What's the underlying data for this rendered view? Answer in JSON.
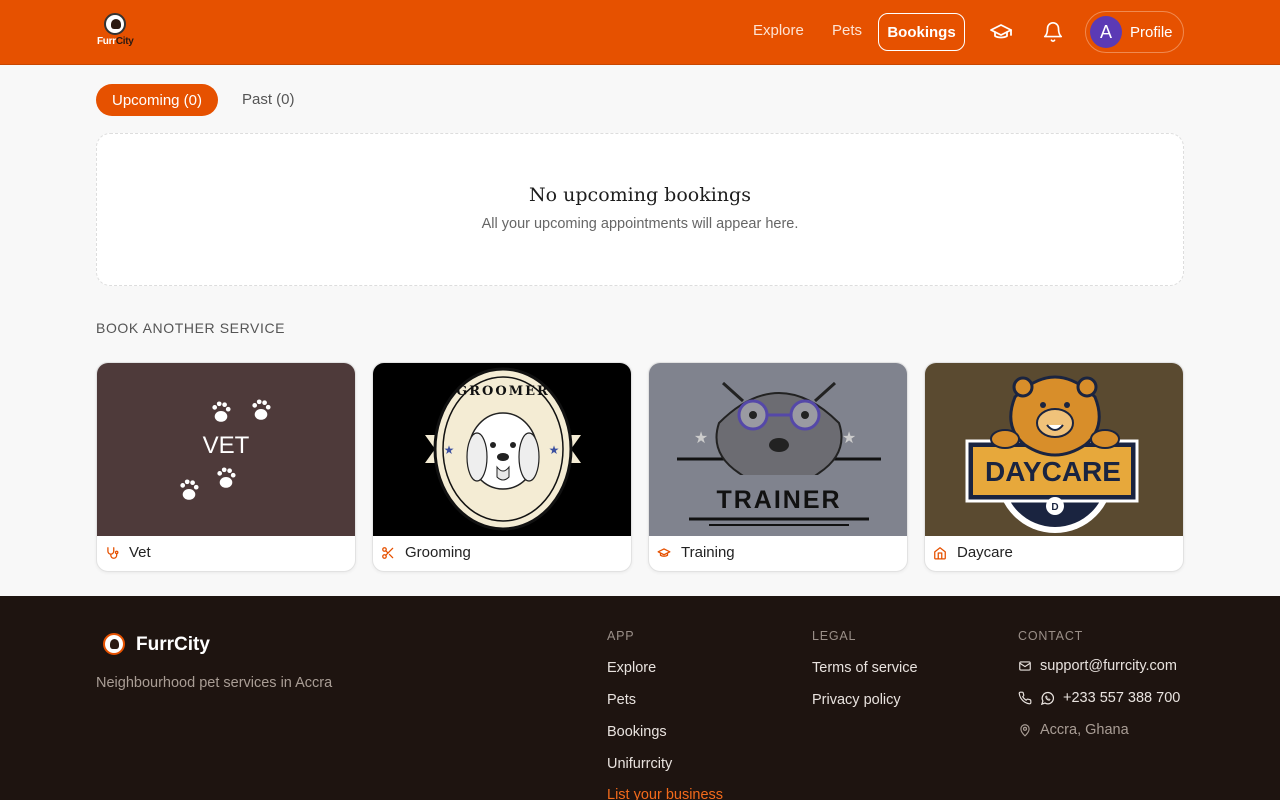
{
  "header": {
    "logo_text_a": "Furr",
    "logo_text_b": "City",
    "nav": {
      "explore": "Explore",
      "pets": "Pets",
      "bookings": "Bookings"
    },
    "profile": {
      "avatar_initial": "A",
      "label": "Profile"
    },
    "icons": [
      "graduation-cap-icon",
      "bell-icon"
    ]
  },
  "tabs": {
    "upcoming": "Upcoming (0)",
    "past": "Past (0)"
  },
  "empty_state": {
    "title": "No upcoming bookings",
    "message": "All your upcoming appointments will appear here."
  },
  "services": {
    "section_title": "BOOK ANOTHER SERVICE",
    "items": [
      {
        "label": "Vet",
        "icon": "stethoscope-icon",
        "image_text": "VET"
      },
      {
        "label": "Grooming",
        "icon": "scissors-icon",
        "image_text": "GROOMER"
      },
      {
        "label": "Training",
        "icon": "graduation-cap-icon",
        "image_text": "TRAINER"
      },
      {
        "label": "Daycare",
        "icon": "house-icon",
        "image_text": "DAYCARE",
        "image_subtext": "D"
      }
    ]
  },
  "footer": {
    "brand": "FurrCity",
    "tagline": "Neighbourhood pet services in Accra",
    "app": {
      "heading": "APP",
      "links": [
        "Explore",
        "Pets",
        "Bookings",
        "Unifurrcity",
        "List your business"
      ]
    },
    "legal": {
      "heading": "LEGAL",
      "links": [
        "Terms of service",
        "Privacy policy"
      ]
    },
    "contact": {
      "heading": "CONTACT",
      "email": "support@furrcity.com",
      "phone": "+233 557 388 700",
      "location": "Accra, Ghana"
    }
  },
  "colors": {
    "brand": "#e65100",
    "footer_bg": "#1e1410",
    "accent_link": "#f26a1b"
  }
}
